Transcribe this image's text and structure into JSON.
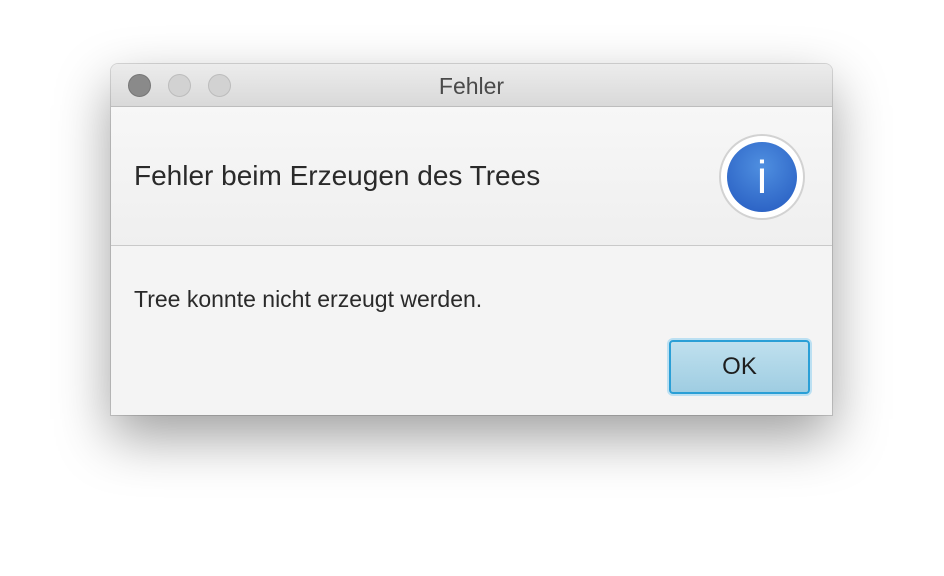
{
  "window": {
    "title": "Fehler"
  },
  "dialog": {
    "header_text": "Fehler beim Erzeugen des Trees",
    "info_icon_glyph": "i",
    "message": "Tree konnte nicht erzeugt werden.",
    "ok_label": "OK"
  },
  "icons": {
    "info": "info-icon",
    "close": "close-icon",
    "minimize": "minimize-icon",
    "zoom": "zoom-icon"
  },
  "colors": {
    "accent": "#2a9fd6",
    "info_blue": "#2f6fd3",
    "button_fill": "#aed6e8",
    "background": "#f4f4f4"
  }
}
